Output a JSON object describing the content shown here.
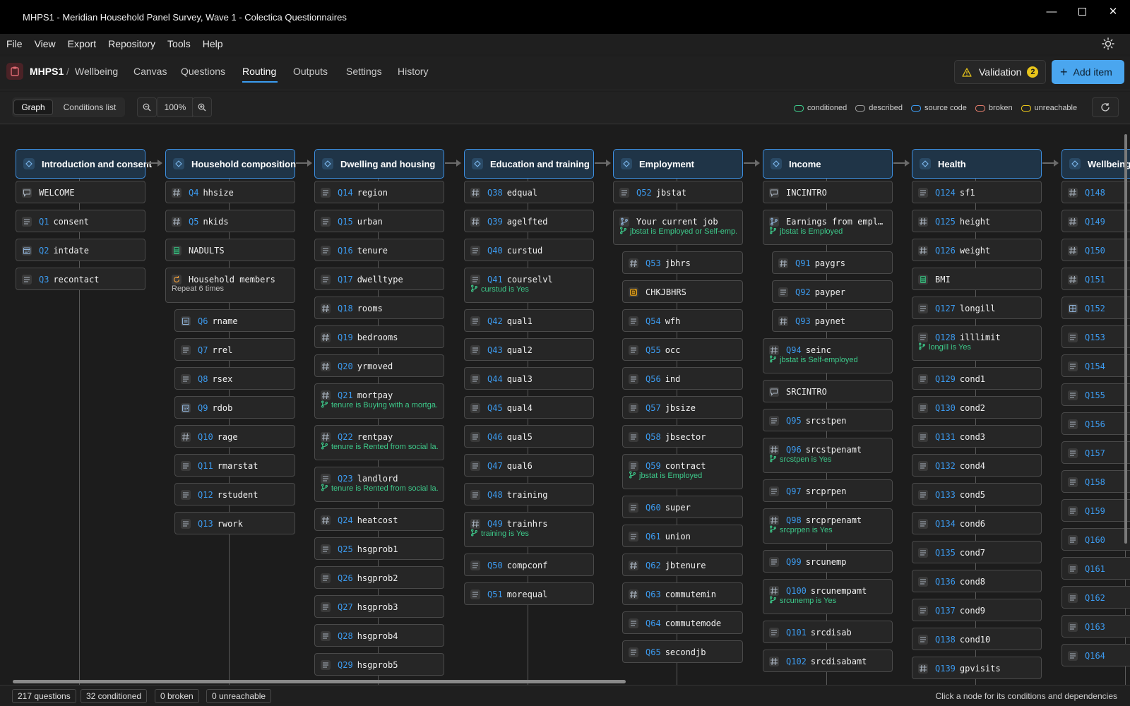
{
  "window": {
    "title": "MHPS1 - Meridian Household Panel Survey, Wave 1 - Colectica Questionnaires"
  },
  "menu": [
    "File",
    "View",
    "Export",
    "Repository",
    "Tools",
    "Help"
  ],
  "header": {
    "crumb_project": "MHPS1",
    "crumb_separator": "/",
    "crumb_section": "Wellbeing",
    "tabs": [
      "Canvas",
      "Questions",
      "Routing",
      "Outputs",
      "Settings",
      "History"
    ],
    "active_tab": "Routing",
    "validation_label": "Validation",
    "validation_count": "2",
    "add_label": "Add item"
  },
  "toolbar": {
    "view_graph": "Graph",
    "view_conditions": "Conditions list",
    "zoom": "100%",
    "legend": [
      {
        "label": "conditioned",
        "color": "#3dc98a"
      },
      {
        "label": "described",
        "color": "#9a9a9a"
      },
      {
        "label": "source code",
        "color": "#3c9bf0"
      },
      {
        "label": "broken",
        "color": "#e07a6a"
      },
      {
        "label": "unreachable",
        "color": "#e8c51a"
      }
    ]
  },
  "columns": [
    {
      "title": "Introduction and consent",
      "nodes": [
        {
          "icon": "statement",
          "num": "",
          "name": "WELCOME"
        },
        {
          "icon": "text",
          "num": "Q1",
          "name": "consent"
        },
        {
          "icon": "date",
          "num": "Q2",
          "name": "intdate"
        },
        {
          "icon": "text",
          "num": "Q3",
          "name": "recontact"
        }
      ]
    },
    {
      "title": "Household composition",
      "nodes": [
        {
          "icon": "number",
          "num": "Q4",
          "name": "hhsize"
        },
        {
          "icon": "number",
          "num": "Q5",
          "name": "nkids"
        },
        {
          "icon": "calc",
          "num": "",
          "name": "NADULTS"
        },
        {
          "icon": "loop",
          "num": "",
          "name": "Household members",
          "sub": "Repeat 6 times"
        },
        {
          "icon": "list",
          "num": "Q6",
          "name": "rname",
          "indent": true
        },
        {
          "icon": "text",
          "num": "Q7",
          "name": "rrel",
          "indent": true
        },
        {
          "icon": "text",
          "num": "Q8",
          "name": "rsex",
          "indent": true
        },
        {
          "icon": "date",
          "num": "Q9",
          "name": "rdob",
          "indent": true
        },
        {
          "icon": "number",
          "num": "Q10",
          "name": "rage",
          "indent": true
        },
        {
          "icon": "text",
          "num": "Q11",
          "name": "rmarstat",
          "indent": true
        },
        {
          "icon": "text",
          "num": "Q12",
          "name": "rstudent",
          "indent": true
        },
        {
          "icon": "text",
          "num": "Q13",
          "name": "rwork",
          "indent": true
        }
      ]
    },
    {
      "title": "Dwelling and housing",
      "nodes": [
        {
          "icon": "text",
          "num": "Q14",
          "name": "region"
        },
        {
          "icon": "text",
          "num": "Q15",
          "name": "urban"
        },
        {
          "icon": "text",
          "num": "Q16",
          "name": "tenure"
        },
        {
          "icon": "text",
          "num": "Q17",
          "name": "dwelltype"
        },
        {
          "icon": "number",
          "num": "Q18",
          "name": "rooms"
        },
        {
          "icon": "number",
          "num": "Q19",
          "name": "bedrooms"
        },
        {
          "icon": "number",
          "num": "Q20",
          "name": "yrmoved"
        },
        {
          "icon": "number",
          "num": "Q21",
          "name": "mortpay",
          "cond": "tenure is Buying with a mortga..."
        },
        {
          "icon": "number",
          "num": "Q22",
          "name": "rentpay",
          "cond": "tenure is Rented from social la..."
        },
        {
          "icon": "text",
          "num": "Q23",
          "name": "landlord",
          "cond": "tenure is Rented from social la..."
        },
        {
          "icon": "number",
          "num": "Q24",
          "name": "heatcost"
        },
        {
          "icon": "text",
          "num": "Q25",
          "name": "hsgprob1"
        },
        {
          "icon": "text",
          "num": "Q26",
          "name": "hsgprob2"
        },
        {
          "icon": "text",
          "num": "Q27",
          "name": "hsgprob3"
        },
        {
          "icon": "text",
          "num": "Q28",
          "name": "hsgprob4"
        },
        {
          "icon": "text",
          "num": "Q29",
          "name": "hsgprob5"
        }
      ]
    },
    {
      "title": "Education and training",
      "nodes": [
        {
          "icon": "number",
          "num": "Q38",
          "name": "edqual"
        },
        {
          "icon": "number",
          "num": "Q39",
          "name": "agelfted"
        },
        {
          "icon": "text",
          "num": "Q40",
          "name": "curstud"
        },
        {
          "icon": "text",
          "num": "Q41",
          "name": "courselvl",
          "cond": "curstud is Yes"
        },
        {
          "icon": "text",
          "num": "Q42",
          "name": "qual1"
        },
        {
          "icon": "text",
          "num": "Q43",
          "name": "qual2"
        },
        {
          "icon": "text",
          "num": "Q44",
          "name": "qual3"
        },
        {
          "icon": "text",
          "num": "Q45",
          "name": "qual4"
        },
        {
          "icon": "text",
          "num": "Q46",
          "name": "qual5"
        },
        {
          "icon": "text",
          "num": "Q47",
          "name": "qual6"
        },
        {
          "icon": "text",
          "num": "Q48",
          "name": "training"
        },
        {
          "icon": "number",
          "num": "Q49",
          "name": "trainhrs",
          "cond": "training is Yes"
        },
        {
          "icon": "text",
          "num": "Q50",
          "name": "compconf"
        },
        {
          "icon": "text",
          "num": "Q51",
          "name": "morequal"
        }
      ]
    },
    {
      "title": "Employment",
      "nodes": [
        {
          "icon": "text",
          "num": "Q52",
          "name": "jbstat"
        },
        {
          "icon": "branch",
          "num": "",
          "name": "Your current job",
          "cond": "jbstat is Employed or Self-emp..."
        },
        {
          "icon": "number",
          "num": "Q53",
          "name": "jbhrs",
          "indent": true
        },
        {
          "icon": "check",
          "num": "",
          "name": "CHKJBHRS",
          "indent": true
        },
        {
          "icon": "text",
          "num": "Q54",
          "name": "wfh",
          "indent": true
        },
        {
          "icon": "text",
          "num": "Q55",
          "name": "occ",
          "indent": true
        },
        {
          "icon": "text",
          "num": "Q56",
          "name": "ind",
          "indent": true
        },
        {
          "icon": "text",
          "num": "Q57",
          "name": "jbsize",
          "indent": true
        },
        {
          "icon": "text",
          "num": "Q58",
          "name": "jbsector",
          "indent": true
        },
        {
          "icon": "text",
          "num": "Q59",
          "name": "contract",
          "cond": "jbstat is Employed",
          "indent": true
        },
        {
          "icon": "text",
          "num": "Q60",
          "name": "super",
          "indent": true
        },
        {
          "icon": "text",
          "num": "Q61",
          "name": "union",
          "indent": true
        },
        {
          "icon": "number",
          "num": "Q62",
          "name": "jbtenure",
          "indent": true
        },
        {
          "icon": "number",
          "num": "Q63",
          "name": "commutemin",
          "indent": true
        },
        {
          "icon": "text",
          "num": "Q64",
          "name": "commutemode",
          "indent": true
        },
        {
          "icon": "text",
          "num": "Q65",
          "name": "secondjb",
          "indent": true
        }
      ]
    },
    {
      "title": "Income",
      "nodes": [
        {
          "icon": "statement",
          "num": "",
          "name": "INCINTRO"
        },
        {
          "icon": "branch",
          "num": "",
          "name": "Earnings from employ...",
          "cond": "jbstat is Employed"
        },
        {
          "icon": "number",
          "num": "Q91",
          "name": "paygrs",
          "indent": true
        },
        {
          "icon": "text",
          "num": "Q92",
          "name": "payper",
          "indent": true
        },
        {
          "icon": "number",
          "num": "Q93",
          "name": "paynet",
          "indent": true
        },
        {
          "icon": "number",
          "num": "Q94",
          "name": "seinc",
          "cond": "jbstat is Self-employed"
        },
        {
          "icon": "statement",
          "num": "",
          "name": "SRCINTRO"
        },
        {
          "icon": "text",
          "num": "Q95",
          "name": "srcstpen"
        },
        {
          "icon": "number",
          "num": "Q96",
          "name": "srcstpenamt",
          "cond": "srcstpen is Yes"
        },
        {
          "icon": "text",
          "num": "Q97",
          "name": "srcprpen"
        },
        {
          "icon": "number",
          "num": "Q98",
          "name": "srcprpenamt",
          "cond": "srcprpen is Yes"
        },
        {
          "icon": "text",
          "num": "Q99",
          "name": "srcunemp"
        },
        {
          "icon": "number",
          "num": "Q100",
          "name": "srcunempamt",
          "cond": "srcunemp is Yes"
        },
        {
          "icon": "text",
          "num": "Q101",
          "name": "srcdisab"
        },
        {
          "icon": "number",
          "num": "Q102",
          "name": "srcdisabamt"
        }
      ]
    },
    {
      "title": "Health",
      "nodes": [
        {
          "icon": "text",
          "num": "Q124",
          "name": "sf1"
        },
        {
          "icon": "number",
          "num": "Q125",
          "name": "height"
        },
        {
          "icon": "number",
          "num": "Q126",
          "name": "weight"
        },
        {
          "icon": "calc",
          "num": "",
          "name": "BMI"
        },
        {
          "icon": "text",
          "num": "Q127",
          "name": "longill"
        },
        {
          "icon": "text",
          "num": "Q128",
          "name": "illlimit",
          "cond": "longill is Yes"
        },
        {
          "icon": "text",
          "num": "Q129",
          "name": "cond1"
        },
        {
          "icon": "text",
          "num": "Q130",
          "name": "cond2"
        },
        {
          "icon": "text",
          "num": "Q131",
          "name": "cond3"
        },
        {
          "icon": "text",
          "num": "Q132",
          "name": "cond4"
        },
        {
          "icon": "text",
          "num": "Q133",
          "name": "cond5"
        },
        {
          "icon": "text",
          "num": "Q134",
          "name": "cond6"
        },
        {
          "icon": "text",
          "num": "Q135",
          "name": "cond7"
        },
        {
          "icon": "text",
          "num": "Q136",
          "name": "cond8"
        },
        {
          "icon": "text",
          "num": "Q137",
          "name": "cond9"
        },
        {
          "icon": "text",
          "num": "Q138",
          "name": "cond10"
        },
        {
          "icon": "number",
          "num": "Q139",
          "name": "gpvisits"
        }
      ]
    },
    {
      "title": "Wellbeing",
      "nodes": [
        {
          "icon": "number",
          "num": "Q148",
          "name": ""
        },
        {
          "icon": "number",
          "num": "Q149",
          "name": ""
        },
        {
          "icon": "number",
          "num": "Q150",
          "name": ""
        },
        {
          "icon": "number",
          "num": "Q151",
          "name": ""
        },
        {
          "icon": "grid",
          "num": "Q152",
          "name": ""
        },
        {
          "icon": "text",
          "num": "Q153",
          "name": ""
        },
        {
          "icon": "text",
          "num": "Q154",
          "name": ""
        },
        {
          "icon": "text",
          "num": "Q155",
          "name": ""
        },
        {
          "icon": "text",
          "num": "Q156",
          "name": ""
        },
        {
          "icon": "text",
          "num": "Q157",
          "name": ""
        },
        {
          "icon": "text",
          "num": "Q158",
          "name": ""
        },
        {
          "icon": "text",
          "num": "Q159",
          "name": ""
        },
        {
          "icon": "text",
          "num": "Q160",
          "name": ""
        },
        {
          "icon": "text",
          "num": "Q161",
          "name": ""
        },
        {
          "icon": "text",
          "num": "Q162",
          "name": ""
        },
        {
          "icon": "text",
          "num": "Q163",
          "name": ""
        },
        {
          "icon": "text",
          "num": "Q164",
          "name": ""
        }
      ]
    }
  ],
  "status": {
    "questions": "217 questions",
    "conditioned": "32 conditioned",
    "broken": "0 broken",
    "unreachable": "0 unreachable",
    "hint": "Click a node for its conditions and dependencies"
  }
}
